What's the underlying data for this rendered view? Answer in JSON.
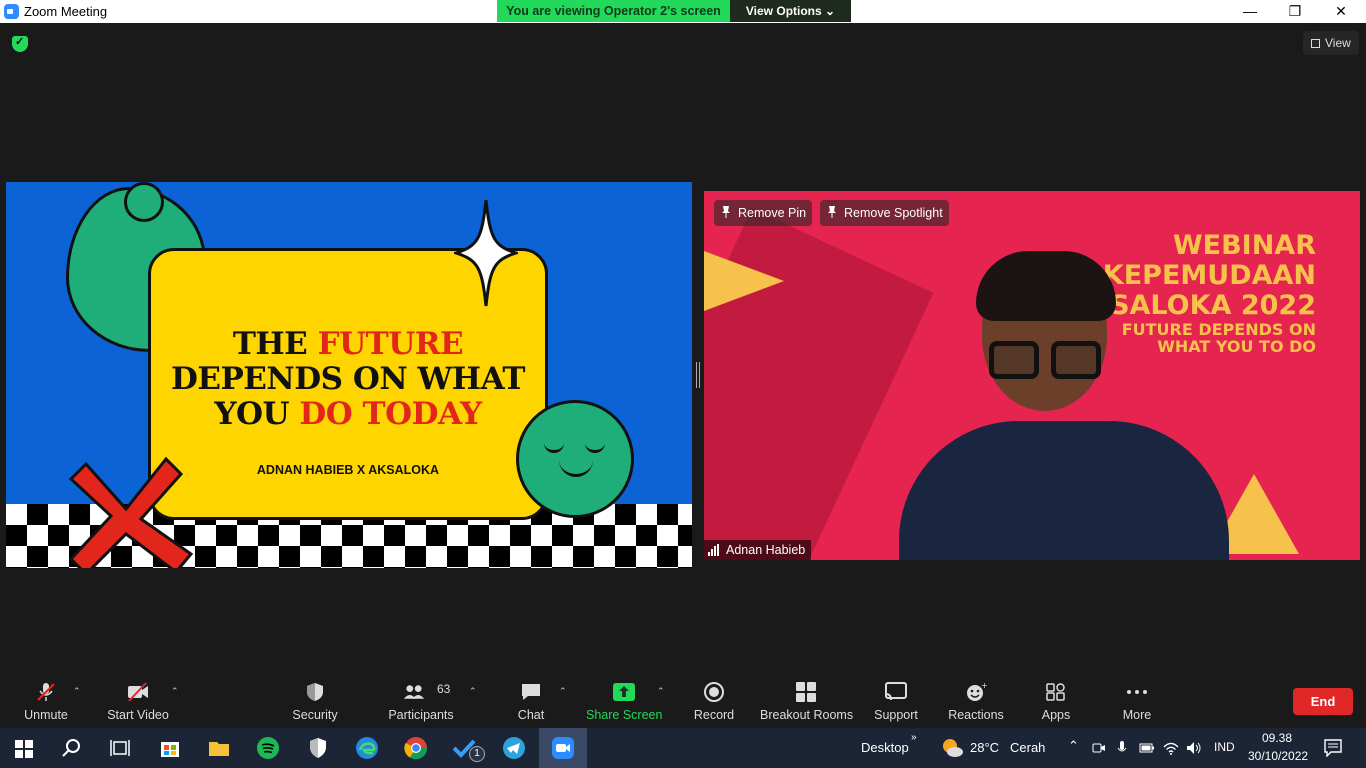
{
  "window": {
    "title": "Zoom Meeting"
  },
  "share_banner": {
    "text": "You are viewing Operator 2's screen",
    "view_options": "View Options"
  },
  "top_right": {
    "view_label": "View"
  },
  "slide": {
    "title_part1": "THE ",
    "title_red1": "FUTURE",
    "title_part2": "DEPENDS ON WHAT",
    "title_part3": "YOU ",
    "title_red2": "DO TODAY",
    "subtitle": "ADNAN HABIEB X AKSALOKA"
  },
  "video": {
    "remove_pin": "Remove Pin",
    "remove_spotlight": "Remove Spotlight",
    "banner_line1": "WEBINAR KEPEMUDAAN",
    "banner_line2": "KSALOKA 2022",
    "banner_line3": "FUTURE DEPENDS ON",
    "banner_line4": "WHAT YOU TO DO",
    "participant_name": "Adnan Habieb"
  },
  "toolbar": {
    "unmute": "Unmute",
    "start_video": "Start Video",
    "security": "Security",
    "participants": "Participants",
    "participants_count": "63",
    "chat": "Chat",
    "share_screen": "Share Screen",
    "record": "Record",
    "breakout_rooms": "Breakout Rooms",
    "support": "Support",
    "reactions": "Reactions",
    "apps": "Apps",
    "more": "More",
    "end": "End"
  },
  "taskbar": {
    "desktop_label": "Desktop",
    "weather_temp": "28°C",
    "weather_desc": "Cerah",
    "language": "IND",
    "time": "09.38",
    "date": "30/10/2022",
    "badge_count": "1"
  },
  "colors": {
    "share_green": "#23d959",
    "end_red": "#e02828",
    "slide_blue": "#0b63d6",
    "slide_yellow": "#ffd500",
    "video_bg": "#e5244f"
  }
}
